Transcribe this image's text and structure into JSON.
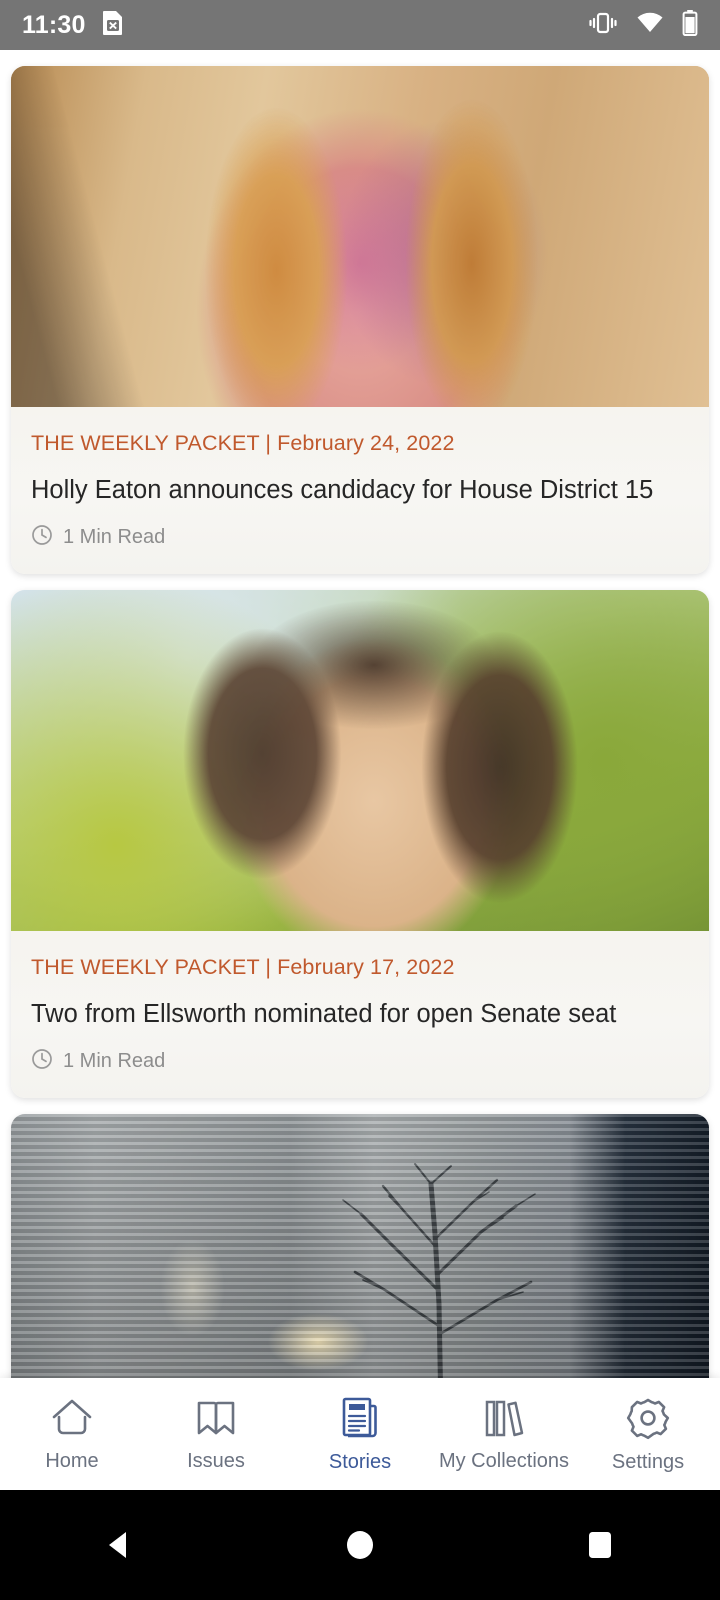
{
  "status_bar": {
    "time": "11:30",
    "icons": [
      "no-sim-card-icon",
      "vibrate-icon",
      "wifi-icon",
      "battery-icon"
    ]
  },
  "feed": {
    "cards": [
      {
        "publication": "THE WEEKLY PACKET",
        "separator": " | ",
        "date": "February 24, 2022",
        "kicker": "THE WEEKLY PACKET | February 24, 2022",
        "headline": "Holly Eaton announces candidacy for House District 15",
        "read_time": "1 Min Read",
        "image_alt": "portrait-woman-red-hair-stone-wall"
      },
      {
        "publication": "THE WEEKLY PACKET",
        "separator": " | ",
        "date": "February 17, 2022",
        "kicker": "THE WEEKLY PACKET | February 17, 2022",
        "headline": "Two from Ellsworth nominated for open Senate seat",
        "read_time": "1 Min Read",
        "image_alt": "portrait-woman-curly-hair-green-foliage"
      },
      {
        "kicker": "",
        "headline": "",
        "read_time": "",
        "image_alt": "white-clapboard-house-at-dusk-with-bare-tree"
      }
    ]
  },
  "bottom_nav": {
    "items": [
      {
        "label": "Home",
        "icon": "home-icon",
        "active": false
      },
      {
        "label": "Issues",
        "icon": "open-book-icon",
        "active": false
      },
      {
        "label": "Stories",
        "icon": "newspaper-icon",
        "active": true
      },
      {
        "label": "My Collections",
        "icon": "bookshelf-icon",
        "active": false
      },
      {
        "label": "Settings",
        "icon": "gear-icon",
        "active": false
      }
    ],
    "active_color": "#3d5a99",
    "inactive_color": "#6b7280"
  },
  "system_nav": {
    "buttons": [
      "back-button",
      "home-button",
      "recents-button"
    ]
  },
  "colors": {
    "accent_orange": "#c0592d",
    "headline": "#262626",
    "meta_gray": "#8d8d8d",
    "status_bar_bg": "#757575",
    "card_text_bg": "#f6f4ef"
  }
}
